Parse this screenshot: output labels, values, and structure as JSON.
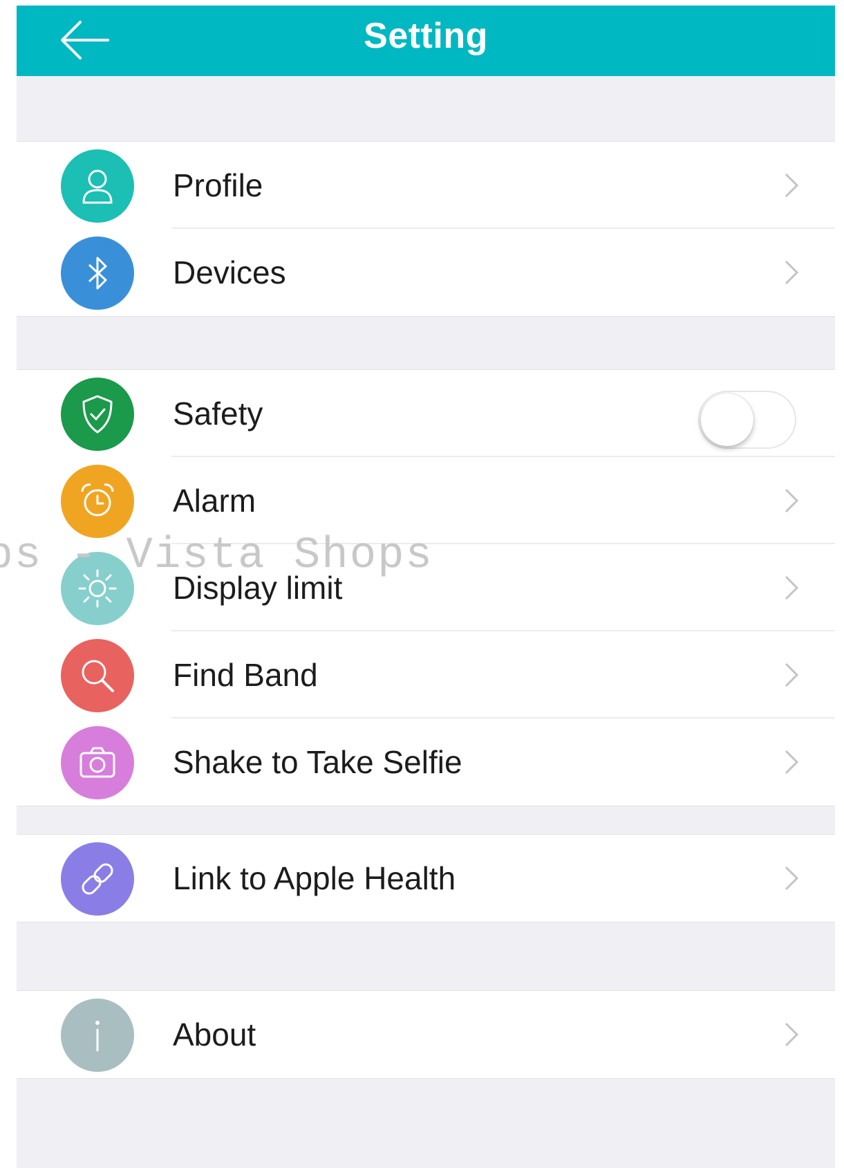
{
  "header": {
    "title": "Setting",
    "color": "#00b8c2"
  },
  "groups": [
    {
      "items": [
        {
          "label": "Profile",
          "icon": "person-icon",
          "color": "#1bbfb3",
          "control": "chevron"
        },
        {
          "label": "Devices",
          "icon": "bluetooth-icon",
          "color": "#3a8fd9",
          "control": "chevron"
        }
      ]
    },
    {
      "items": [
        {
          "label": "Safety",
          "icon": "shield-check-icon",
          "color": "#1a9a4a",
          "control": "toggle",
          "toggle_on": false
        },
        {
          "label": "Alarm",
          "icon": "alarm-clock-icon",
          "color": "#f0a522",
          "control": "chevron"
        },
        {
          "label": "Display limit",
          "icon": "sun-icon",
          "color": "#86cfcd",
          "control": "chevron"
        },
        {
          "label": "Find Band",
          "icon": "magnifier-icon",
          "color": "#e8625f",
          "control": "chevron"
        },
        {
          "label": "Shake to Take Selfie",
          "icon": "camera-icon",
          "color": "#d77edc",
          "control": "chevron"
        }
      ]
    },
    {
      "items": [
        {
          "label": "Link to Apple Health",
          "icon": "link-icon",
          "color": "#8a7ee6",
          "control": "chevron"
        }
      ]
    },
    {
      "items": [
        {
          "label": "About",
          "icon": "info-icon",
          "color": "#a9bec0",
          "control": "chevron"
        }
      ]
    }
  ],
  "watermark": "ops - Vista Shops"
}
